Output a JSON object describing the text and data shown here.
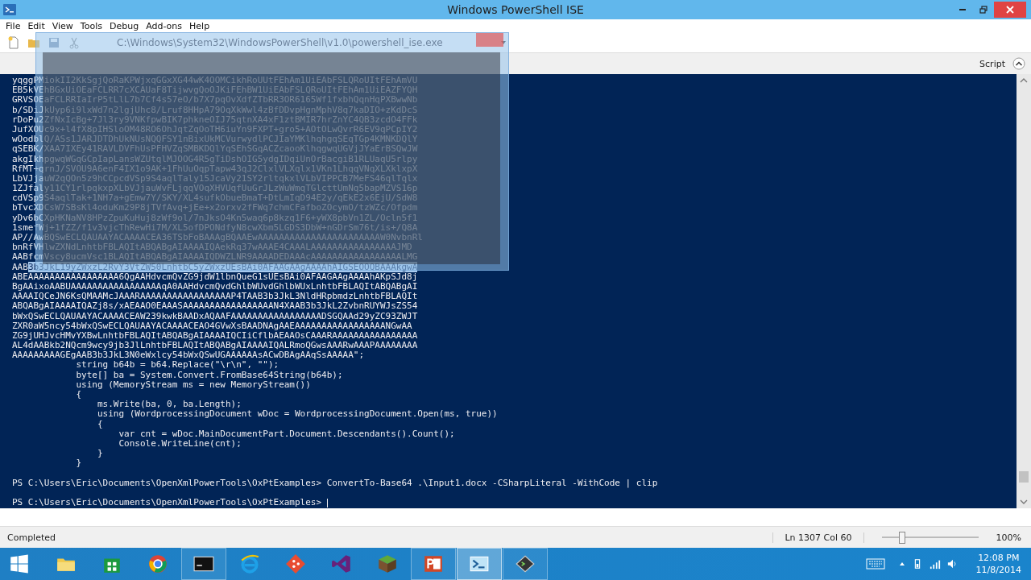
{
  "window": {
    "title": "Windows PowerShell ISE"
  },
  "menu": [
    "File",
    "Edit",
    "View",
    "Tools",
    "Debug",
    "Add-ons",
    "Help"
  ],
  "drag_ghost": {
    "title": "C:\\Windows\\System32\\WindowsPowerShell\\v1.0\\powershell_ise.exe"
  },
  "pane_toggle": {
    "label": "Script"
  },
  "console": {
    "lines": [
      {
        "text": "yqggPMiokII2KkSgjQoRaKPWjxqGGxXG44wK4OOMCikhRoUUtFEhAm1UiEAbFSLQRoUItFEhAmVU"
      },
      {
        "text": "EB5kVEhBGxUiOEaFCLRR7cXCAUaF8TijwvgQoOJKiFEhBW1UiEAbFSLQRoUItFEhAm1UiEAZFYQH"
      },
      {
        "text": "GRVSOEaFCLRRIaIrP5tLlL7b7Cf4s57eO/b7X7pqOvXdfZTbRR3OR6165Wf1fxbhQqnHqPXBwwNb"
      },
      {
        "text": "b/SDiJkUyp6i9lxWd7n2lgjUhc8/Lruf8HHpA79OqXkWwl4zBfDDvpHgnMphV8q7kaDIO+zKdDcS"
      },
      {
        "text": "rDoPu2ZfNxIcBg+7Jl3ry9VNKfpwBIK7phkneOIJ75qtnXA4xF1ztBMIR7hrZnYC4QB3zcdO4FFk"
      },
      {
        "text": "JufXOUc9x+l4fX8pIHSloOM48RO6OhJqtZqOoTH6iuYn9FXPT+gro5+AOtOLwQvrR6EV9qPCpIY2"
      },
      {
        "text": "wOodblQ/ASs1JARJDTDhUkNUsNQQFSY1nBixUkMCVurwydlPCJIaYMKlhqhgqSEqTGp4KMNKDQlY"
      },
      {
        "text": "qSEBK/XAA7IXEy41RAVLDVFhUsPFHVZqSMBKDQlYqSEhSGqACZcaooKlhqgwqUGVjJYaErBSQwJW"
      },
      {
        "text": "akgIkhpgwqWGqGCpIapLansWZUtqlMJOOG4R5gTiDshOIG5ydgIDqiUnOrBacgiB1RLUaqU5rlpy"
      },
      {
        "text": "RfMT+qrnJ/SVOU9A6enF4IX1o9AK+1FhUuOqpTapw43qJ2ClxlVLXqlx1VKn1LhqqVNqXLXklxpX"
      },
      {
        "text": "LbVJjauW2qQOn5z9hCCpcdVSp9S4aqlTaly15JcaVy21SY2rltqkxlVLbVIPPCB7MeFS46qlTqlx"
      },
      {
        "text": "1ZJfaly11CY1rlpqkxpXLbVJjauWvFLjqqVOqXHVUqfUuGrJLzWuWmqTGlcttUmNq5bapMZVS16p"
      },
      {
        "text": "cdVSp9S4aqlTak+1NH7a+gEmw7Y/SKY/XL4sufkObueBmaT+DtLmIqD94E2y/qEkE2x6EjU/SdW8"
      },
      {
        "text": "bTvcXDCsW7SBsKl4oduKm29P8jTVfAvq+jEe+x2orxv2fFWq7chmCFafboZOcymO/tzWZc/Ofpdm"
      },
      {
        "text": "yDv6bCXpHKNaNV8HPzZpuKuHuj8zWf9ol/7nJksO4Kn5waq6p8kzq1F6+yWX8pbVn1ZL/Ocln5f1"
      },
      {
        "text": "1smefWj+1fZZ/f1v3vjcThRewHi7M/XL5ofDPONdfyN8cwXbm5LGDS3DbW+nGDrSm76t/is+/Q8A"
      },
      {
        "text": "AP//AwBQSwECLQAUAAYACAAAACEA36TSbFoBAAAgBQAAEwAAAAAAAAAAAAAAAAAAAAAAAW0NvbnRl"
      },
      {
        "text": "bnRfVHlwZXNdLnhtbFBLAQItABQABgAIAAAAIQAekRq37wAAAE4CAAALAAAAAAAAAAAAAAAAJMD"
      },
      {
        "text": "AABfcmVscy8ucmVsc1BLAQItABQABgAIAAAAIQDWZLNR9AAAADEDAAAcAAAAAAAAAAAAAAAAALMG"
      },
      {
        "text": "AAB",
        "highlight": "3b3JkL19yZWxzL2RvY3VtZW50LnhtbC5yZWxzUEsBAi0AFAAGAAgAAAAhAIGSEOOQBAAAkgwA"
      },
      {
        "text": "ABEAAAAAAAAAAAAAAAAA6QgAAHdvcmQvZG9jdW1lbnQueG1sUEsBAi0AFAAGAAgAAAAhAKpSJd8j"
      },
      {
        "text": "BgAAixoAABUAAAAAAAAAAAAAAAAAqA0AAHdvcmQvdGhlbWUvdGhlbWUxLnhtbFBLAQItABQABgAI"
      },
      {
        "text": "AAAAIQCeJN6KsQMAAMcJAAARAAAAAAAAAAAAAAAAAP4TAAB3b3JkL3NldHRpbmdzLnhtbFBLAQIt"
      },
      {
        "text": "ABQABgAIAAAAIQAZj8s/xAEAAO0EAAASAAAAAAAAAAAAAAAAAN4XAAB3b3JkL2ZvbnRUYWJsZS54"
      },
      {
        "text": "bWxQSwECLQAUAAYACAAAACEAW239kwkBAADxAQAAFAAAAAAAAAAAAAAAAADSGQAAd29yZC93ZWJT"
      },
      {
        "text": "ZXR0aW5ncy54bWxQSwECLQAUAAYACAAAACEAO4GVwXsBAADNAgAAEAAAAAAAAAAAAAAAAANGwAA"
      },
      {
        "text": "ZG9jUHJvcHMvYXBwLnhtbFBLAQItABQABgAIAAAAIQCIiCflbAEAAOsCAAARAAAAAAAAAAAAAAAA"
      },
      {
        "text": "AL4dAABkb2NQcm9wcy9jb3JlLnhtbFBLAQItABQABgAIAAAAIQALRmoQGwsAAARwAAAPAAAAAAAA"
      },
      {
        "text": "AAAAAAAAAGEgAAB3b3JkL3N0eWxlcy54bWxQSwUGAAAAAAsACwDBAgAAqSsAAAAA\";"
      },
      {
        "text": "            string b64b = b64.Replace(\"\\r\\n\", \"\");"
      },
      {
        "text": "            byte[] ba = System.Convert.FromBase64String(b64b);"
      },
      {
        "text": "            using (MemoryStream ms = new MemoryStream())"
      },
      {
        "text": "            {"
      },
      {
        "text": "                ms.Write(ba, 0, ba.Length);"
      },
      {
        "text": "                using (WordprocessingDocument wDoc = WordprocessingDocument.Open(ms, true))"
      },
      {
        "text": "                {"
      },
      {
        "text": "                    var cnt = wDoc.MainDocumentPart.Document.Descendants().Count();"
      },
      {
        "text": "                    Console.WriteLine(cnt);"
      },
      {
        "text": "                }"
      },
      {
        "text": "            }"
      }
    ],
    "commands": [
      {
        "text": "PS C:\\Users\\Eric\\Documents\\OpenXmlPowerTools\\OxPtExamples> ConvertTo-Base64 .\\Input1.docx -CSharpLiteral -WithCode | clip",
        "cursor": false
      },
      {
        "text": "PS C:\\Users\\Eric\\Documents\\OpenXmlPowerTools\\OxPtExamples>",
        "cursor": true
      }
    ]
  },
  "status_bar": {
    "status": "Completed",
    "position": "Ln 1307 Col 60",
    "zoom": {
      "level": 0.2,
      "label": "100%"
    }
  },
  "taskbar": {
    "apps": [
      {
        "selected": false
      },
      {
        "selected": false
      },
      {
        "selected": false
      },
      {
        "selected": false
      },
      {
        "selected": false
      },
      {
        "selected": false
      },
      {
        "selected": false
      },
      {
        "selected": false
      },
      {
        "selected": false
      },
      {
        "selected": true
      },
      {
        "selected": false
      }
    ],
    "time": "12:08 PM",
    "date": "11/8/2014"
  }
}
